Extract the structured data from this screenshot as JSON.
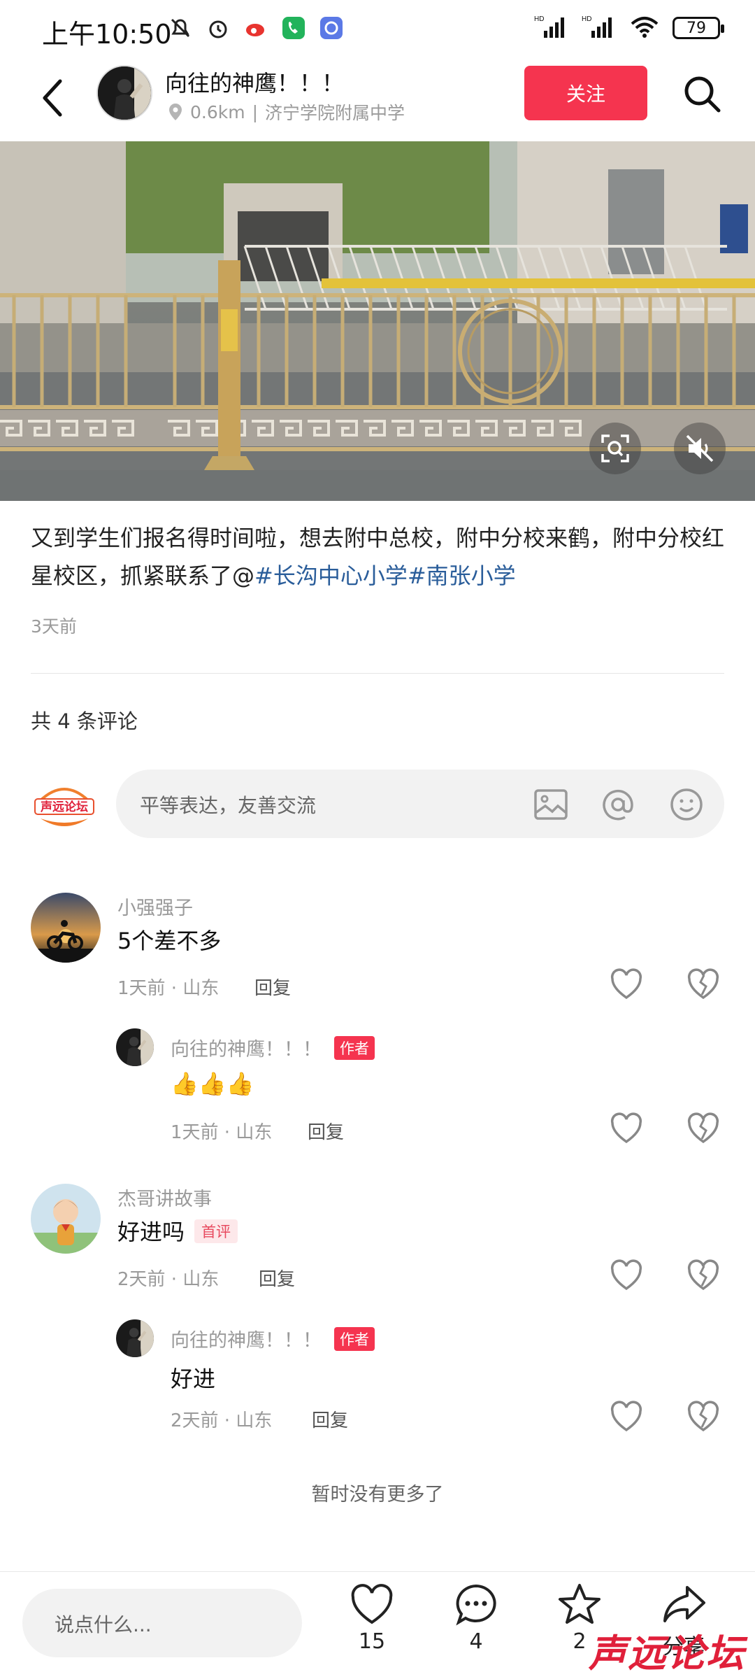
{
  "status_bar": {
    "time": "上午10:50",
    "battery": "79"
  },
  "header": {
    "author_name": "向往的神鹰！！！",
    "distance": "0.6km",
    "separator": "|",
    "location": "济宁学院附属中学",
    "follow_label": "关注"
  },
  "post": {
    "text_plain": "又到学生们报名得时间啦，想去附中总校，附中分校来鹤，附中分校红星校区，抓紧联系了@",
    "hashtag_1": "#长沟中心小学",
    "hashtag_2": "#南张小学",
    "time": "3天前"
  },
  "comments_header": {
    "count_label": "共 4 条评论"
  },
  "composer": {
    "placeholder": "平等表达，友善交流"
  },
  "comments": [
    {
      "name": "小强强子",
      "text": "5个差不多",
      "meta": "1天前 · 山东",
      "reply_label": "回复",
      "replies": [
        {
          "name": "向往的神鹰！！！",
          "tag": "作者",
          "text": "👍👍👍",
          "meta": "1天前 · 山东",
          "reply_label": "回复"
        }
      ]
    },
    {
      "name": "杰哥讲故事",
      "text": "好进吗",
      "tag": "首评",
      "meta": "2天前 · 山东",
      "reply_label": "回复",
      "replies": [
        {
          "name": "向往的神鹰！！！",
          "tag": "作者",
          "text": "好进",
          "meta": "2天前 · 山东",
          "reply_label": "回复"
        }
      ]
    }
  ],
  "no_more": "暂时没有更多了",
  "bottom_bar": {
    "say_placeholder": "说点什么...",
    "likes": "15",
    "comments": "4",
    "favorites": "2",
    "share_label": "分享"
  },
  "watermark": "声远论坛",
  "colors": {
    "accent": "#f5344f",
    "hashtag": "#2a5d9a",
    "muted": "#9a9a9a"
  }
}
